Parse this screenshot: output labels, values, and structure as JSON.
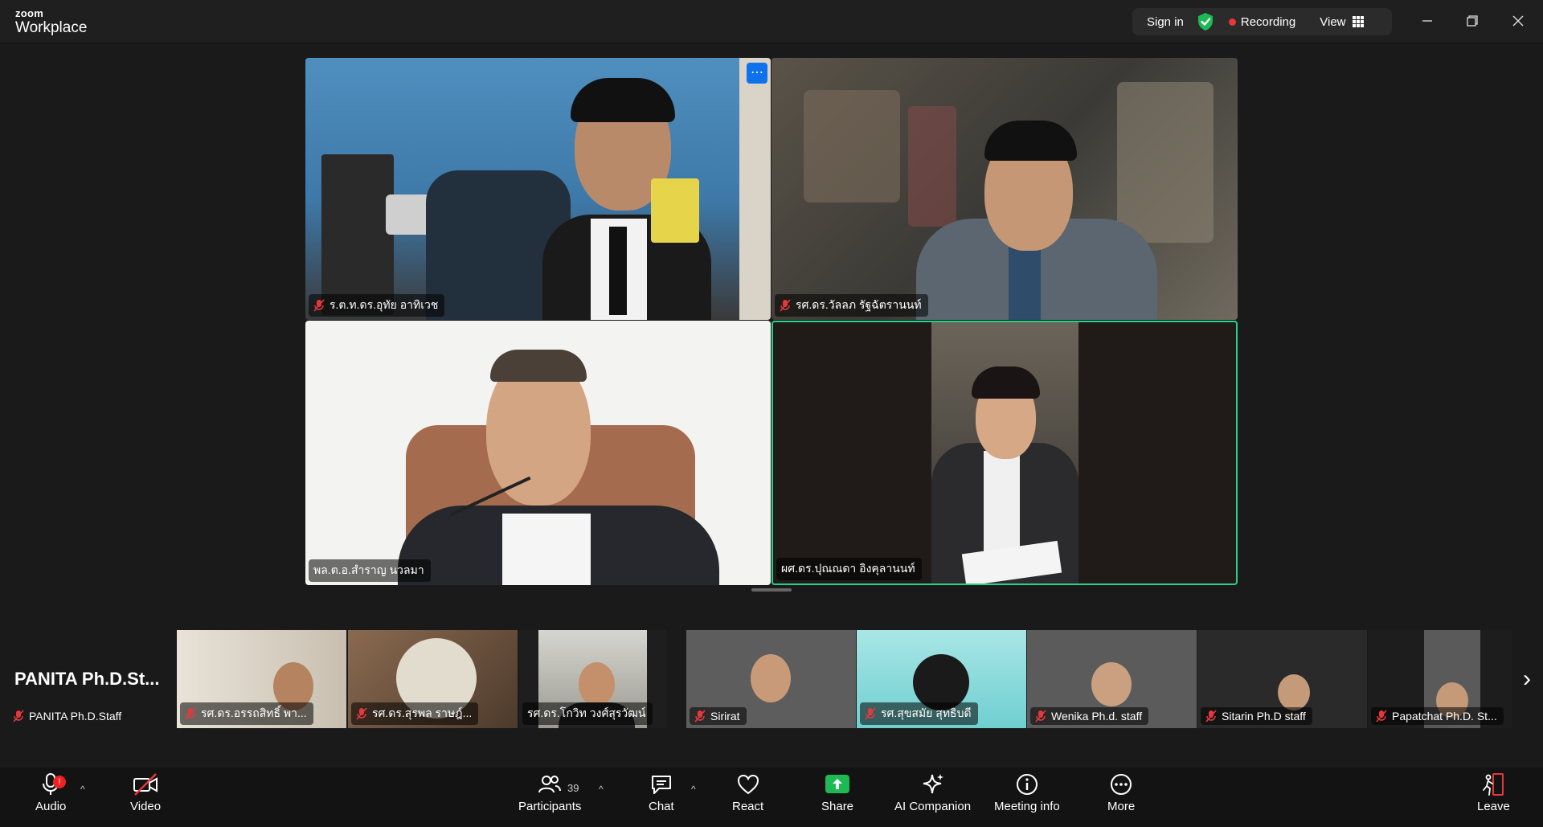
{
  "app": {
    "logo_top": "zoom",
    "logo_bottom": "Workplace"
  },
  "topbar": {
    "sign_in": "Sign in",
    "recording": "Recording",
    "view": "View"
  },
  "gallery": [
    {
      "name": "ร.ต.ท.ดร.อุทัย  อาทิเวช",
      "muted": true
    },
    {
      "name": "รศ.ดร.วัลลภ รัฐฉัตรานนท์",
      "muted": true
    },
    {
      "name": "พล.ต.อ.สำราญ นวลมา",
      "muted": false
    },
    {
      "name": "ผศ.ดร.ปุณณดา  อิงคุลานนท์",
      "muted": false,
      "active_speaker": true
    }
  ],
  "strip": {
    "self_big_name": "PANITA  Ph.D.St...",
    "self_name": "PANITA Ph.D.Staff",
    "thumbs": [
      {
        "name": "รศ.ดร.อรรถสิทธิ์  พา..."
      },
      {
        "name": "รศ.ดร.สุรพล  ราษฎ์..."
      },
      {
        "name": "รศ.ดร.โกวิท  วงศ์สุรวัฒน์"
      },
      {
        "name": "Sirirat"
      },
      {
        "name": "รศ.สุขสมัย สุทธิบดี"
      },
      {
        "name": "Wenika Ph.d. staff"
      },
      {
        "name": "Sitarin Ph.D staff"
      },
      {
        "name": "Papatchat Ph.D. St..."
      }
    ]
  },
  "toolbar": {
    "audio": "Audio",
    "audio_alert": "!",
    "video": "Video",
    "participants": "Participants",
    "participants_count": "39",
    "chat": "Chat",
    "react": "React",
    "share": "Share",
    "ai_companion": "AI Companion",
    "meeting_info": "Meeting info",
    "more": "More",
    "leave": "Leave"
  },
  "colors": {
    "accent_green": "#23d18b",
    "share_green": "#1db954",
    "alert_red": "#e5383b",
    "zoom_blue": "#0e72ed"
  }
}
